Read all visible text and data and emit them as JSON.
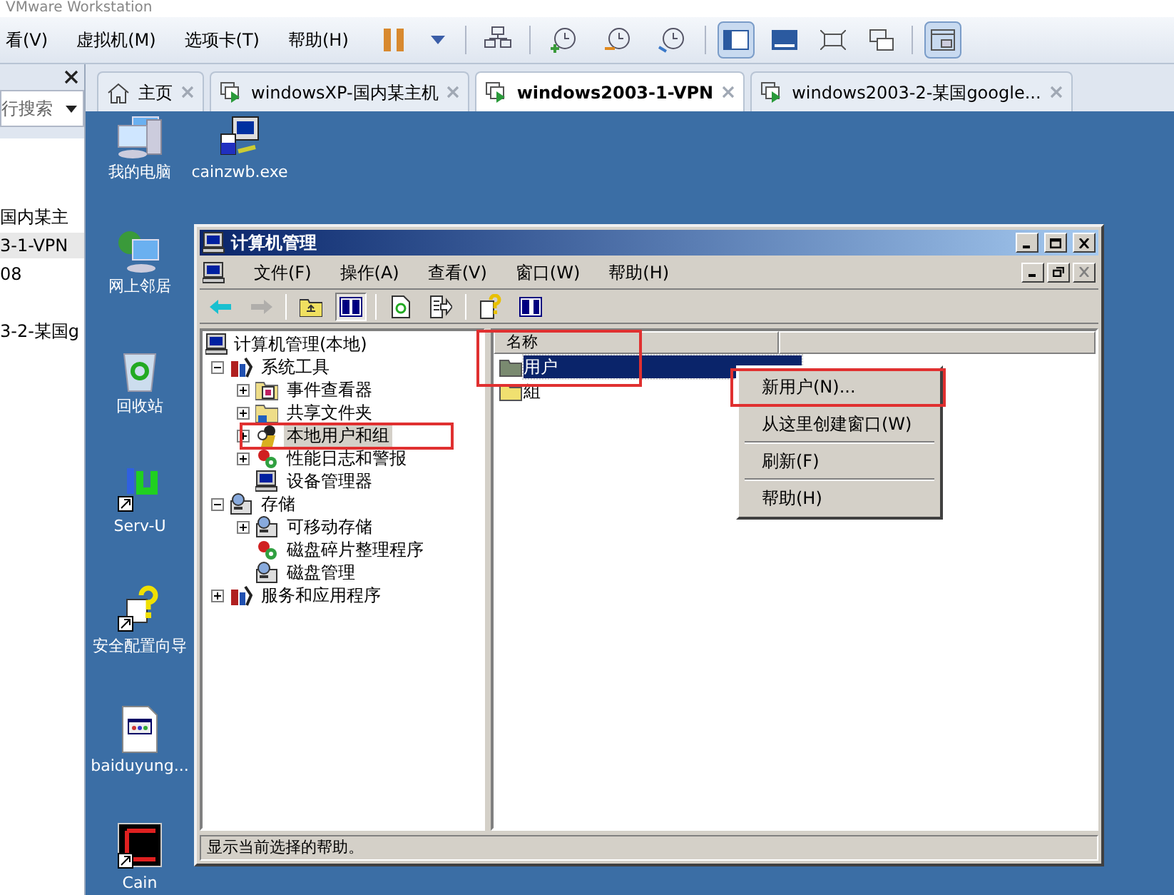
{
  "app": {
    "title": "VMware Workstation"
  },
  "menu": [
    {
      "label": "看(V)"
    },
    {
      "label": "虚拟机(M)"
    },
    {
      "label": "选项卡(T)"
    },
    {
      "label": "帮助(H)"
    }
  ],
  "toolbar": [
    {
      "kind": "pause",
      "pressed": false
    },
    {
      "kind": "caret",
      "pressed": false
    },
    {
      "kind": "sep"
    },
    {
      "kind": "network",
      "pressed": false
    },
    {
      "kind": "sep"
    },
    {
      "kind": "snapshot",
      "pressed": false
    },
    {
      "kind": "revert",
      "pressed": false
    },
    {
      "kind": "manage",
      "pressed": false
    },
    {
      "kind": "sep"
    },
    {
      "kind": "sidebar",
      "pressed": true
    },
    {
      "kind": "console",
      "pressed": false
    },
    {
      "kind": "fullscreen",
      "pressed": false
    },
    {
      "kind": "unity",
      "pressed": false
    },
    {
      "kind": "sep"
    },
    {
      "kind": "thumbnail",
      "pressed": true
    }
  ],
  "library": {
    "placeholder": "行搜索",
    "items": [
      {
        "label": "国内某主",
        "selected": false
      },
      {
        "label": "3-1-VPN",
        "selected": true
      },
      {
        "label": "08",
        "selected": false
      },
      {
        "label": "3-2-某国g",
        "selected": false
      }
    ]
  },
  "tabs": [
    {
      "label": "主页",
      "kind": "home",
      "selected": false
    },
    {
      "label": "windowsXP-国内某主机",
      "kind": "vm",
      "selected": false
    },
    {
      "label": "windows2003-1-VPN",
      "kind": "vm",
      "selected": true
    },
    {
      "label": "windows2003-2-某国google...",
      "kind": "vm",
      "selected": false
    }
  ],
  "desktop": {
    "icons": [
      {
        "label": "我的电脑",
        "kind": "computer"
      },
      {
        "label": "cainzwb.exe",
        "kind": "exe"
      },
      {
        "label": "网上邻居",
        "kind": "network"
      },
      {
        "label": "回收站",
        "kind": "recycle"
      },
      {
        "label": "Serv-U",
        "kind": "servu"
      },
      {
        "label": "安全配置向导",
        "kind": "wizard"
      },
      {
        "label": "baiduyung...",
        "kind": "doc"
      },
      {
        "label": "Cain",
        "kind": "cain"
      }
    ]
  },
  "mmc": {
    "title": "计算机管理",
    "menu": [
      {
        "label": "文件(F)"
      },
      {
        "label": "操作(A)"
      },
      {
        "label": "查看(V)"
      },
      {
        "label": "窗口(W)"
      },
      {
        "label": "帮助(H)"
      }
    ],
    "toolbar": [
      {
        "kind": "back",
        "disabled": false
      },
      {
        "kind": "forward",
        "disabled": true
      },
      {
        "kind": "sep"
      },
      {
        "kind": "up",
        "disabled": false
      },
      {
        "kind": "tree",
        "disabled": false,
        "pressed": true
      },
      {
        "kind": "sep"
      },
      {
        "kind": "refresh",
        "disabled": false
      },
      {
        "kind": "export",
        "disabled": false
      },
      {
        "kind": "sep"
      },
      {
        "kind": "help",
        "disabled": false
      },
      {
        "kind": "pane",
        "disabled": false
      }
    ],
    "tree": [
      {
        "label": "计算机管理(本地)",
        "kind": "computer",
        "selected": false,
        "children": [
          {
            "label": "系统工具",
            "kind": "tools",
            "expanded": true,
            "selected": false,
            "children": [
              {
                "label": "事件查看器",
                "kind": "event",
                "expanded": false,
                "selected": false
              },
              {
                "label": "共享文件夹",
                "kind": "folder",
                "expanded": false,
                "selected": false
              },
              {
                "label": "本地用户和组",
                "kind": "users",
                "expanded": false,
                "selected": true
              },
              {
                "label": "性能日志和警报",
                "kind": "perf",
                "expanded": false,
                "selected": false
              },
              {
                "label": "设备管理器",
                "kind": "computer",
                "selected": false
              }
            ]
          },
          {
            "label": "存储",
            "kind": "storage",
            "expanded": true,
            "selected": false,
            "children": [
              {
                "label": "可移动存储",
                "kind": "storage",
                "expanded": false,
                "selected": false
              },
              {
                "label": "磁盘碎片整理程序",
                "kind": "perf",
                "selected": false
              },
              {
                "label": "磁盘管理",
                "kind": "storage",
                "selected": false
              }
            ]
          },
          {
            "label": "服务和应用程序",
            "kind": "tools",
            "expanded": false,
            "selected": false
          }
        ]
      }
    ],
    "list": {
      "columns": [
        "名称"
      ],
      "rows": [
        {
          "label": "用户",
          "kind": "gray",
          "selected": true
        },
        {
          "label": "組",
          "kind": "yellow",
          "selected": false
        }
      ]
    },
    "context_menu": [
      {
        "label": "新用户(N)..."
      },
      {
        "label": "从这里创建窗口(W)"
      },
      {
        "label": "刷新(F)"
      },
      {
        "label": "帮助(H)"
      }
    ],
    "status_bar": "显示当前选择的帮助。"
  }
}
